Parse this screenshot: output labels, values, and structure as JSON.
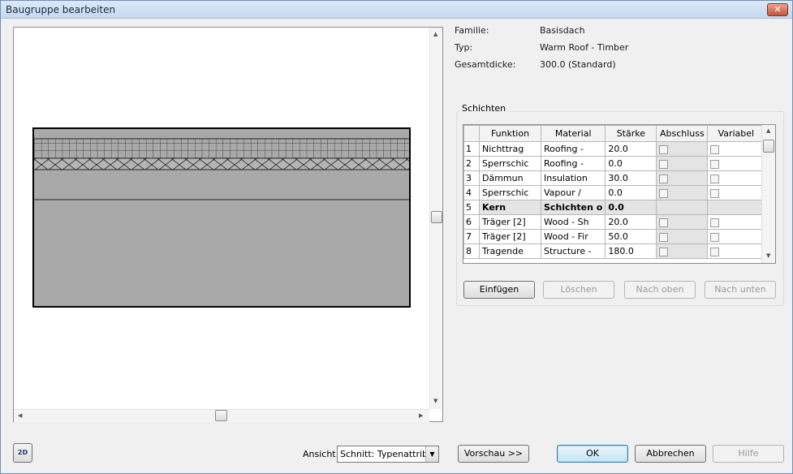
{
  "window": {
    "title": "Baugruppe bearbeiten",
    "close_glyph": "✕"
  },
  "properties": [
    {
      "label": "Familie:",
      "value": "Basisdach"
    },
    {
      "label": "Typ:",
      "value": "Warm Roof - Timber"
    },
    {
      "label": "Gesamtdicke:",
      "value": "300.0 (Standard)"
    }
  ],
  "layers": {
    "group_label": "Schichten",
    "columns": [
      "Funktion",
      "Material",
      "Stärke",
      "Abschluss",
      "Variabel"
    ],
    "rows": [
      {
        "num": "1",
        "funktion": "Nichttrag",
        "material": "Roofing -",
        "staerke": "20.0",
        "abschluss": false,
        "variabel": false,
        "kern": false
      },
      {
        "num": "2",
        "funktion": "Sperrschic",
        "material": "Roofing -",
        "staerke": "0.0",
        "abschluss": false,
        "variabel": false,
        "kern": false
      },
      {
        "num": "3",
        "funktion": "Dämmun",
        "material": "Insulation",
        "staerke": "30.0",
        "abschluss": false,
        "variabel": false,
        "kern": false
      },
      {
        "num": "4",
        "funktion": "Sperrschic",
        "material": "Vapour /",
        "staerke": "0.0",
        "abschluss": false,
        "variabel": false,
        "kern": false
      },
      {
        "num": "5",
        "funktion": "Kern",
        "material": "Schichten o",
        "staerke": "0.0",
        "kern": true
      },
      {
        "num": "6",
        "funktion": "Träger [2]",
        "material": "Wood - Sh",
        "staerke": "20.0",
        "abschluss": false,
        "variabel": false,
        "kern": false
      },
      {
        "num": "7",
        "funktion": "Träger [2]",
        "material": "Wood - Fir",
        "staerke": "50.0",
        "abschluss": false,
        "variabel": false,
        "kern": false
      },
      {
        "num": "8",
        "funktion": "Tragende",
        "material": "Structure -",
        "staerke": "180.0",
        "abschluss": false,
        "variabel": false,
        "kern": false
      }
    ],
    "buttons": {
      "insert": "Einfügen",
      "delete": "Löschen",
      "up": "Nach oben",
      "down": "Nach unten"
    }
  },
  "footer": {
    "view_label": "Ansicht:",
    "view_value": "Schnitt: Typenattribu",
    "preview_button": "Vorschau >>",
    "ok": "OK",
    "cancel": "Abbrechen",
    "help": "Hilfe",
    "icon_2d_label": "2D"
  },
  "colors": {
    "layer_fill": "#a9a9a9",
    "accent": "#3c7fb1"
  }
}
